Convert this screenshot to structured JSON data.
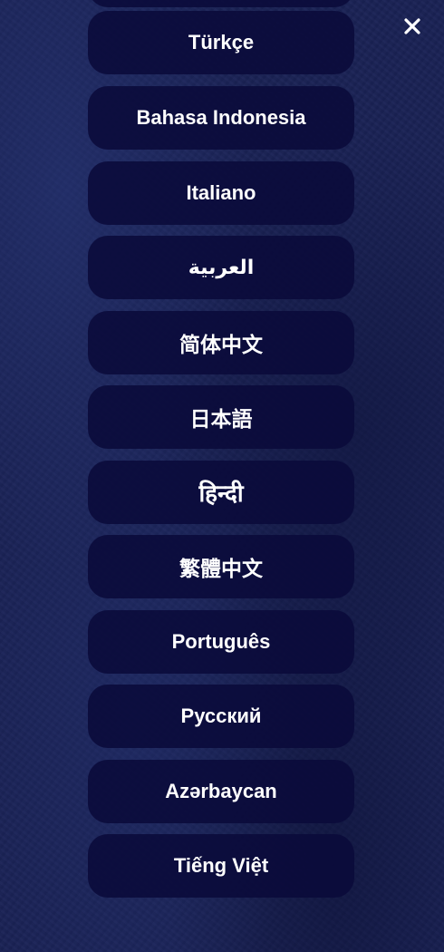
{
  "close_icon": "close-icon",
  "colors": {
    "background": "#1a2255",
    "button_bg": "#0a0a3a",
    "text": "#ffffff"
  },
  "languages": [
    {
      "label": "Türkçe"
    },
    {
      "label": "Bahasa Indonesia"
    },
    {
      "label": "Italiano"
    },
    {
      "label": "العربية"
    },
    {
      "label": "简体中文"
    },
    {
      "label": "日本語"
    },
    {
      "label": "हिन्दी"
    },
    {
      "label": "繁體中文"
    },
    {
      "label": "Português"
    },
    {
      "label": "Русский"
    },
    {
      "label": "Azərbaycan"
    },
    {
      "label": "Tiếng Việt"
    }
  ]
}
